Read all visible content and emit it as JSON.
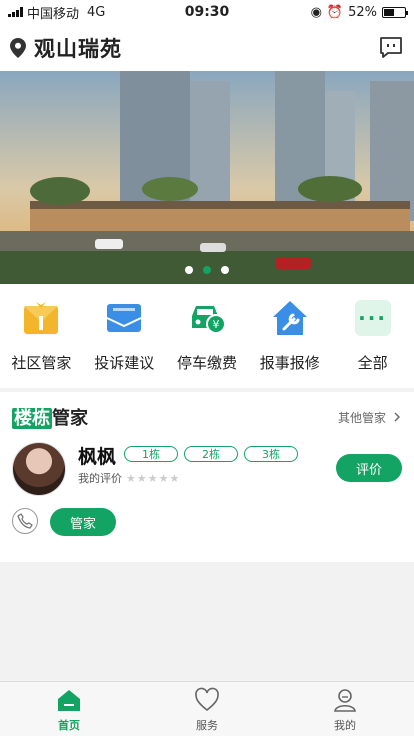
{
  "status": {
    "carrier": "中国移动",
    "network": "4G",
    "time": "09:30",
    "battery": "52%",
    "battery_level": 0.52
  },
  "header": {
    "title": "观山瑞苑"
  },
  "banner": {
    "dots": 3,
    "active_dot": 1
  },
  "quick_actions": [
    {
      "label": "社区管家",
      "icon": "butler-icon"
    },
    {
      "label": "投诉建议",
      "icon": "mail-icon"
    },
    {
      "label": "停车缴费",
      "icon": "car-yuan-icon"
    },
    {
      "label": "报事报修",
      "icon": "repair-house-icon"
    },
    {
      "label": "全部",
      "icon": "more-icon"
    }
  ],
  "manager_card": {
    "title_highlight": "楼栋",
    "title_rest": "管家",
    "more": "其他管家",
    "name": "枫枫",
    "tags": [
      "1栋",
      "2栋",
      "3栋"
    ],
    "rating_label": "我的评价",
    "stars": "★★★★★",
    "rate_button": "评价",
    "role_button": "管家"
  },
  "tabbar": {
    "items": [
      "首页",
      "服务",
      "我的"
    ]
  },
  "colors": {
    "accent": "#13a463"
  }
}
